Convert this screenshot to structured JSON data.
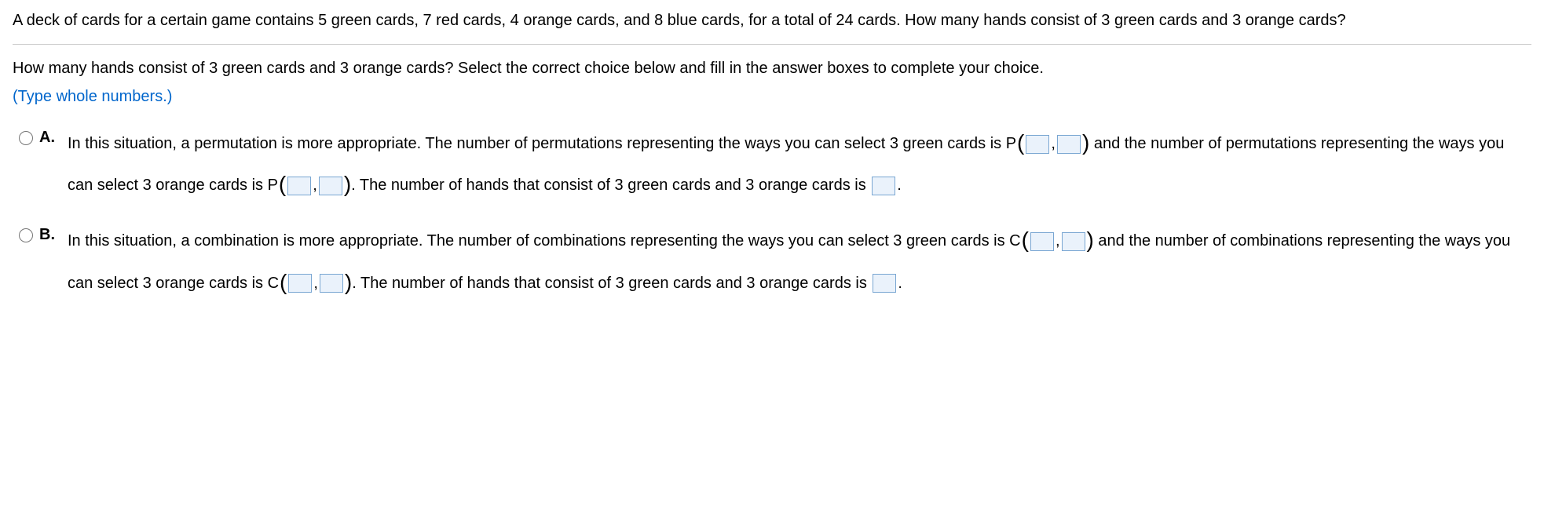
{
  "stem": "A deck of cards for a certain game contains 5 green cards, 7 red cards, 4 orange cards, and 8 blue cards, for a total of 24 cards. How many hands consist of 3 green cards and 3 orange cards?",
  "subQuestion": "How many hands consist of 3 green cards and 3 orange cards? Select the correct choice below and fill in the answer boxes to complete your choice.",
  "instruction": "(Type whole numbers.)",
  "choices": {
    "A": {
      "label": "A.",
      "p1": "In this situation, a permutation is more appropriate. The number of permutations representing the ways you can select 3 green cards is P",
      "p2": " and the number of permutations representing the ways you can select 3 orange cards is P",
      "p3": ". The number of hands that consist of 3 green cards and 3 orange cards is ",
      "end": "."
    },
    "B": {
      "label": "B.",
      "p1": "In this situation, a combination is more appropriate. The number of combinations representing the ways you can select 3 green cards is C",
      "p2": " and the number of combinations representing the ways you can select 3 orange cards is C",
      "p3": ". The number of hands that consist of 3 green cards and 3 orange cards is ",
      "end": "."
    }
  },
  "comma": ","
}
